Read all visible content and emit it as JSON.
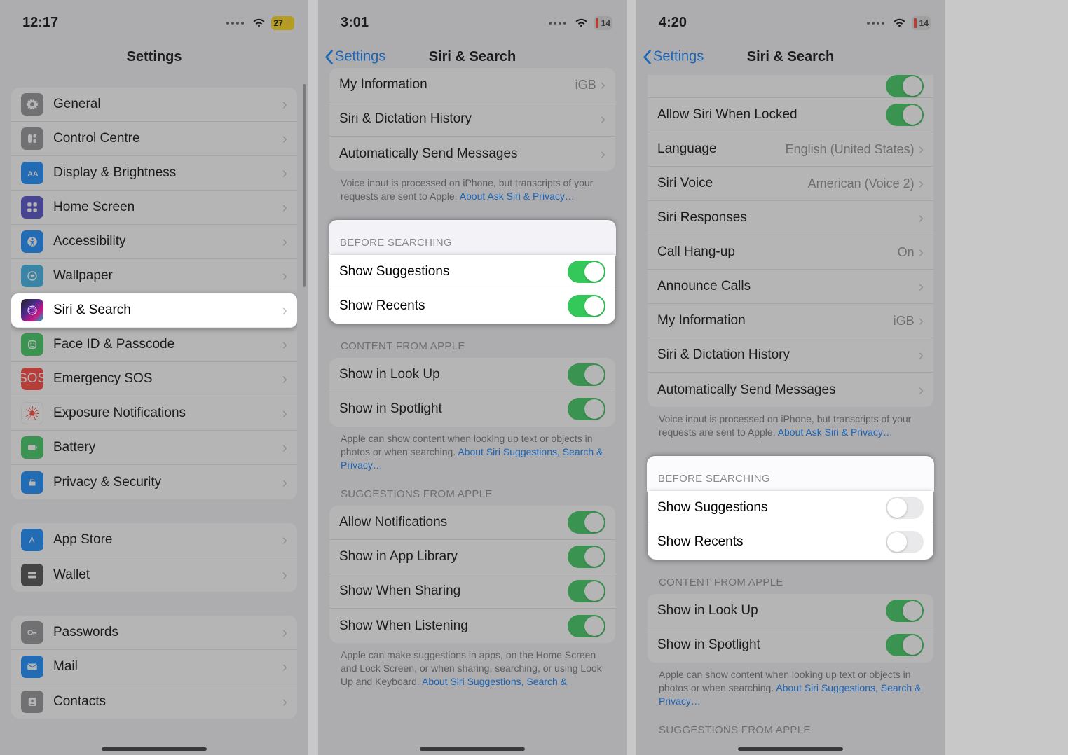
{
  "phone1": {
    "time": "12:17",
    "battery": "27",
    "title": "Settings",
    "groups": [
      [
        {
          "icon": "general",
          "label": "General"
        },
        {
          "icon": "cc",
          "label": "Control Centre"
        },
        {
          "icon": "display",
          "label": "Display & Brightness"
        },
        {
          "icon": "home",
          "label": "Home Screen"
        },
        {
          "icon": "access",
          "label": "Accessibility"
        },
        {
          "icon": "wall",
          "label": "Wallpaper"
        },
        {
          "icon": "siri",
          "label": "Siri & Search",
          "highlight": true
        },
        {
          "icon": "face",
          "label": "Face ID & Passcode"
        },
        {
          "icon": "sos",
          "label": "Emergency SOS"
        },
        {
          "icon": "expo",
          "label": "Exposure Notifications"
        },
        {
          "icon": "batt",
          "label": "Battery"
        },
        {
          "icon": "priv",
          "label": "Privacy & Security"
        }
      ],
      [
        {
          "icon": "apps",
          "label": "App Store"
        },
        {
          "icon": "wallet",
          "label": "Wallet"
        }
      ],
      [
        {
          "icon": "pass",
          "label": "Passwords"
        },
        {
          "icon": "mail",
          "label": "Mail"
        },
        {
          "icon": "contacts",
          "label": "Contacts"
        }
      ]
    ]
  },
  "phone2": {
    "time": "3:01",
    "battery": "14",
    "back": "Settings",
    "title": "Siri & Search",
    "top_rows": [
      {
        "label": "My Information",
        "value": "iGB"
      },
      {
        "label": "Siri & Dictation History"
      },
      {
        "label": "Automatically Send Messages"
      }
    ],
    "top_footer": "Voice input is processed on iPhone, but transcripts of your requests are sent to Apple.",
    "top_footer_link": "About Ask Siri & Privacy…",
    "before_header": "BEFORE SEARCHING",
    "before_rows": [
      {
        "label": "Show Suggestions",
        "on": true
      },
      {
        "label": "Show Recents",
        "on": true
      }
    ],
    "content_header": "CONTENT FROM APPLE",
    "content_rows": [
      {
        "label": "Show in Look Up",
        "on": true
      },
      {
        "label": "Show in Spotlight",
        "on": true
      }
    ],
    "content_footer": "Apple can show content when looking up text or objects in photos or when searching.",
    "content_footer_link": "About Siri Suggestions, Search & Privacy…",
    "sugg_header": "SUGGESTIONS FROM APPLE",
    "sugg_rows": [
      {
        "label": "Allow Notifications",
        "on": true
      },
      {
        "label": "Show in App Library",
        "on": true
      },
      {
        "label": "Show When Sharing",
        "on": true
      },
      {
        "label": "Show When Listening",
        "on": true
      }
    ],
    "sugg_footer": "Apple can make suggestions in apps, on the Home Screen and Lock Screen, or when sharing, searching, or using Look Up and Keyboard.",
    "sugg_footer_link": "About Siri Suggestions, Search &"
  },
  "phone3": {
    "time": "4:20",
    "battery": "14",
    "back": "Settings",
    "title": "Siri & Search",
    "top_rows": [
      {
        "label": "Allow Siri When Locked",
        "toggle": true,
        "on": true
      },
      {
        "label": "Language",
        "value": "English (United States)"
      },
      {
        "label": "Siri Voice",
        "value": "American (Voice 2)"
      },
      {
        "label": "Siri Responses"
      },
      {
        "label": "Call Hang-up",
        "value": "On"
      },
      {
        "label": "Announce Calls"
      },
      {
        "label": "My Information",
        "value": "iGB"
      },
      {
        "label": "Siri & Dictation History"
      },
      {
        "label": "Automatically Send Messages"
      }
    ],
    "top_footer": "Voice input is processed on iPhone, but transcripts of your requests are sent to Apple.",
    "top_footer_link": "About Ask Siri & Privacy…",
    "before_header": "BEFORE SEARCHING",
    "before_rows": [
      {
        "label": "Show Suggestions",
        "on": false
      },
      {
        "label": "Show Recents",
        "on": false
      }
    ],
    "content_header": "CONTENT FROM APPLE",
    "content_rows": [
      {
        "label": "Show in Look Up",
        "on": true
      },
      {
        "label": "Show in Spotlight",
        "on": true
      }
    ],
    "content_footer": "Apple can show content when looking up text or objects in photos or when searching.",
    "content_footer_link": "About Siri Suggestions, Search & Privacy…",
    "sugg_header": "SUGGESTIONS FROM APPLE"
  }
}
